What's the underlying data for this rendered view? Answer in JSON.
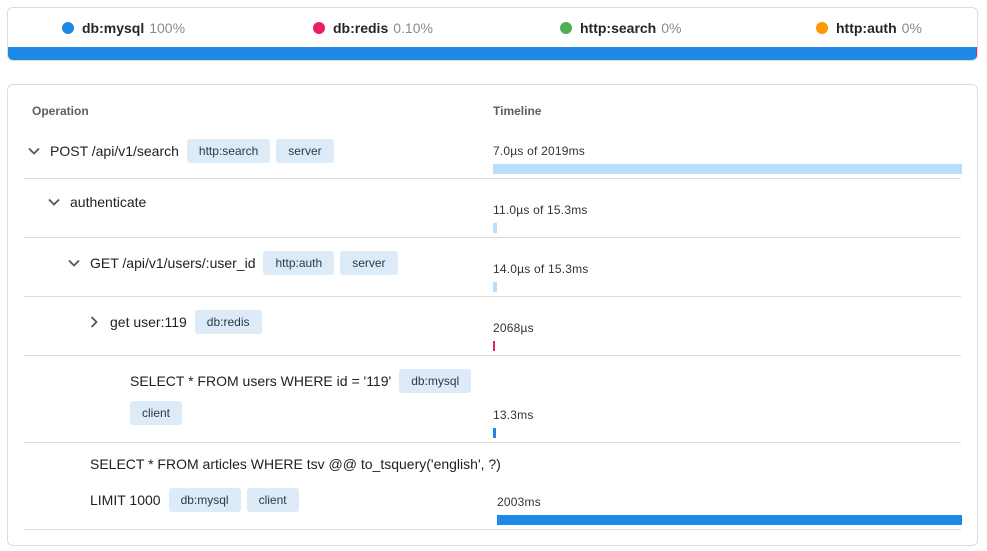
{
  "legend": {
    "items": [
      {
        "name": "db:mysql",
        "pct": "100%",
        "color": "#1e88e5"
      },
      {
        "name": "db:redis",
        "pct": "0.10%",
        "color": "#e91e63"
      },
      {
        "name": "http:search",
        "pct": "0%",
        "color": "#4caf50"
      },
      {
        "name": "http:auth",
        "pct": "0%",
        "color": "#ff9800"
      }
    ],
    "bar_fractions": [
      0.999,
      0.001,
      0,
      0
    ]
  },
  "table": {
    "header_operation": "Operation",
    "header_timeline": "Timeline"
  },
  "rows": [
    {
      "indent": 0,
      "chevron": "down",
      "lines": [
        {
          "text": "POST /api/v1/search",
          "tags": [
            "http:search",
            "server"
          ]
        }
      ],
      "duration_label": "7.0µs of 2019ms",
      "bar": {
        "start": 0.0,
        "fraction": 1.0,
        "color": "#bbdefb"
      }
    },
    {
      "indent": 1,
      "chevron": "down",
      "lines": [
        {
          "text": "authenticate",
          "tags": []
        }
      ],
      "duration_label": "11.0µs of 15.3ms",
      "bar": {
        "start": 0.0,
        "fraction": 0.008,
        "color": "#bbdefb"
      }
    },
    {
      "indent": 2,
      "chevron": "down",
      "lines": [
        {
          "text": "GET /api/v1/users/:user_id",
          "tags": [
            "http:auth",
            "server"
          ]
        }
      ],
      "duration_label": "14.0µs of 15.3ms",
      "bar": {
        "start": 0.0,
        "fraction": 0.008,
        "color": "#bbdefb"
      }
    },
    {
      "indent": 3,
      "chevron": "right",
      "lines": [
        {
          "text": "get user:119",
          "tags": [
            "db:redis"
          ]
        }
      ],
      "duration_label": "2068µs",
      "bar": {
        "start": 0.0,
        "fraction": 0.002,
        "color": "#e91e63"
      }
    },
    {
      "indent": 4,
      "chevron": "none",
      "lines": [
        {
          "text": "SELECT * FROM users WHERE id = '119'",
          "tags": [
            "db:mysql"
          ]
        },
        {
          "text": "",
          "tags": [
            "client"
          ]
        }
      ],
      "duration_label": "13.3ms",
      "bar": {
        "start": 0.0,
        "fraction": 0.007,
        "color": "#1e88e5"
      }
    },
    {
      "indent": 2,
      "chevron": "none",
      "lines": [
        {
          "text": "SELECT * FROM articles WHERE tsv @@ to_tsquery('english', ?)",
          "tags": []
        },
        {
          "text": "LIMIT 1000",
          "tags": [
            "db:mysql",
            "client"
          ]
        }
      ],
      "duration_label": "2003ms",
      "bar": {
        "start": 0.008,
        "fraction": 0.992,
        "color": "#1e88e5"
      }
    }
  ]
}
